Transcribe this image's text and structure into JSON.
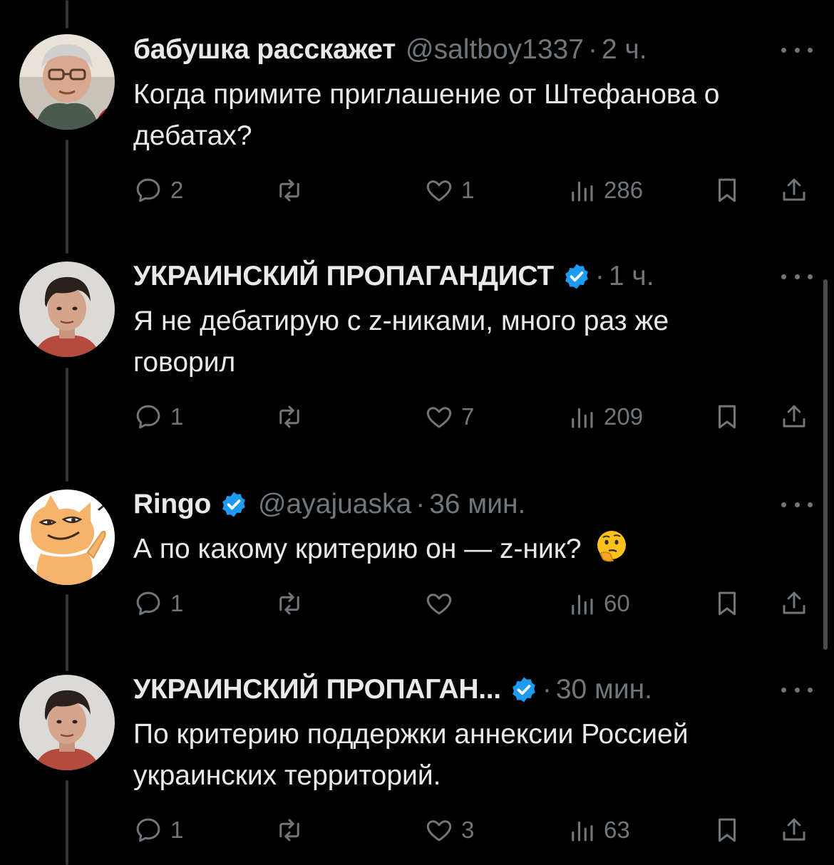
{
  "colors": {
    "background": "#000000",
    "text": "#e7e9ea",
    "muted": "#71767b",
    "verified": "#1d9bf0",
    "thread_line": "#333639"
  },
  "tweets": [
    {
      "name": "бабушка расскажет",
      "verified": false,
      "handle": "@saltboy1337",
      "separator": "·",
      "time": "2 ч.",
      "text": "Когда примите приглашение от Штефанова о дебатах?",
      "emoji": "",
      "avatar_icon": "grandmother-avatar",
      "stats": {
        "replies": "2",
        "reposts": "",
        "likes": "1",
        "views": "286"
      }
    },
    {
      "name": "УКРАИНСКИЙ ПРОПАГАНДИСТ",
      "verified": true,
      "handle": "",
      "separator": "·",
      "time": "1 ч.",
      "text": "Я не дебатирую с z-никами, много раз же говорил",
      "emoji": "",
      "avatar_icon": "young-man-avatar",
      "stats": {
        "replies": "1",
        "reposts": "",
        "likes": "7",
        "views": "209"
      }
    },
    {
      "name": "Ringo",
      "verified": true,
      "handle": "@ayajuaska",
      "separator": "·",
      "time": "36 мин.",
      "text": "А по какому критерию он — z-ник?",
      "emoji": "thinking-face-emoji",
      "avatar_icon": "cartoon-cat-avatar",
      "stats": {
        "replies": "1",
        "reposts": "",
        "likes": "",
        "views": "60"
      }
    },
    {
      "name": "УКРАИНСКИЙ ПРОПАГАН...",
      "verified": true,
      "handle": "",
      "separator": "·",
      "time": "30 мин.",
      "text": "По критерию поддержки аннексии Россией украинских территорий.",
      "emoji": "",
      "avatar_icon": "young-man-avatar",
      "stats": {
        "replies": "1",
        "reposts": "",
        "likes": "3",
        "views": "63"
      }
    }
  ]
}
